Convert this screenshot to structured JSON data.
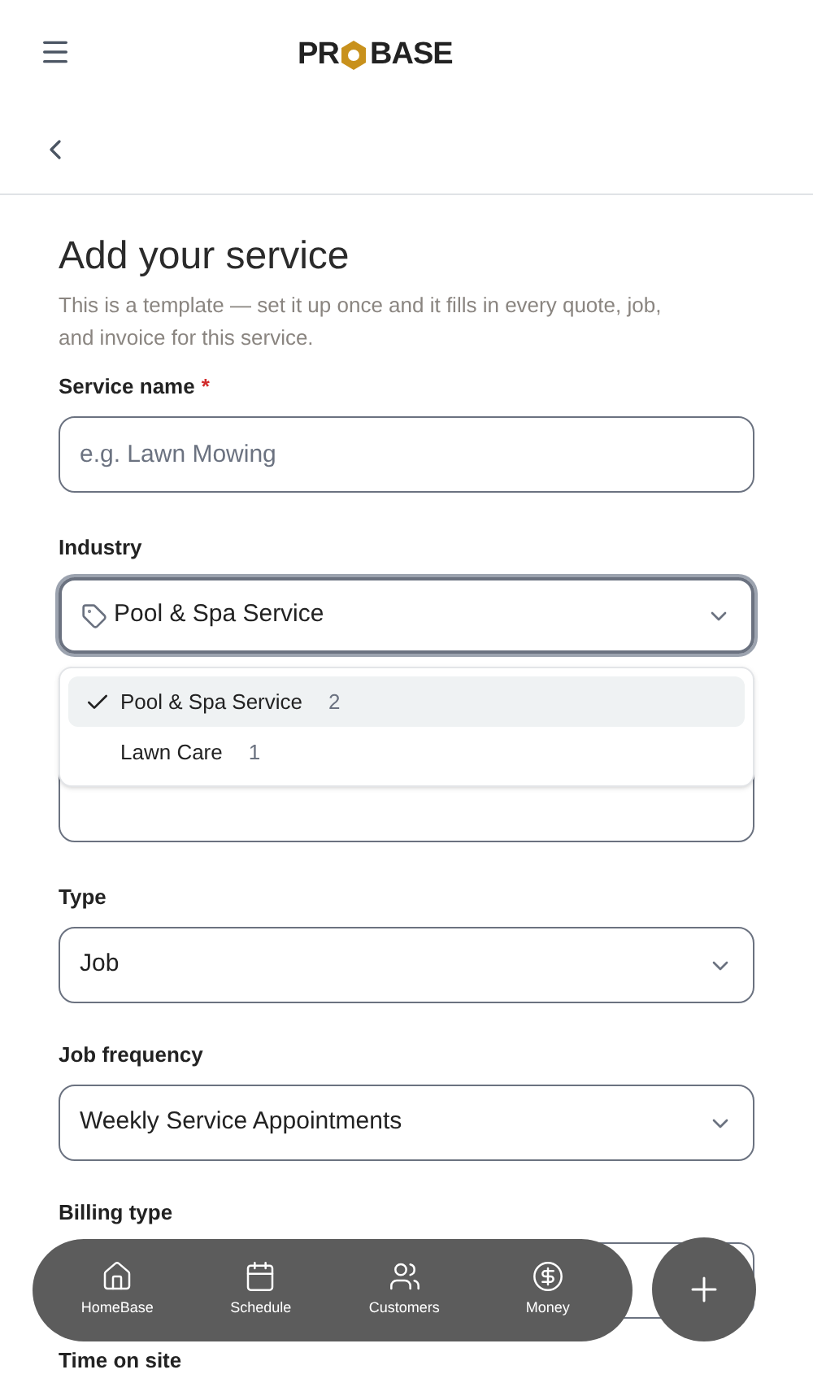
{
  "header": {
    "logo_left": "PR",
    "logo_right": "BASE"
  },
  "title": "Add your service",
  "description": "This is a template — set it up once and it fills in every quote, job, and invoice for this service.",
  "service_name": {
    "label": "Service name",
    "required_mark": "*",
    "placeholder": "e.g. Lawn Mowing"
  },
  "industry": {
    "label": "Industry",
    "value": "Pool & Spa Service",
    "expanded": true,
    "options": [
      {
        "label": "Pool & Spa Service",
        "count": "2",
        "selected": true
      },
      {
        "label": "Lawn Care",
        "count": "1",
        "selected": false
      }
    ]
  },
  "selects": [
    {
      "label": "Type",
      "value": "Job"
    },
    {
      "label": "Job frequency",
      "value": "Weekly Service Appointments"
    },
    {
      "label": "Billing type"
    }
  ],
  "time_on_site": {
    "label": "Time on site"
  },
  "nav": [
    {
      "label": "HomeBase",
      "kind": "home"
    },
    {
      "label": "Schedule",
      "kind": "calendar"
    },
    {
      "label": "Customers",
      "kind": "users"
    },
    {
      "label": "Money",
      "kind": "money"
    }
  ]
}
